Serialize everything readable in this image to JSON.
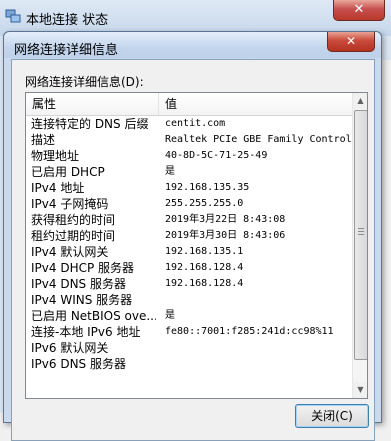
{
  "background_window": {
    "title": "本地连接 状态",
    "close_glyph": "✕",
    "icon": "network-connection-icon"
  },
  "dialog": {
    "title": "网络连接详细信息",
    "close_glyph": "✕",
    "section_label": "网络连接详细信息(D):",
    "columns": [
      "属性",
      "值"
    ],
    "rows": [
      {
        "key": "连接特定的 DNS 后缀",
        "value": "centit.com"
      },
      {
        "key": "描述",
        "value": "Realtek PCIe GBE Family Controller"
      },
      {
        "key": "物理地址",
        "value": "40-8D-5C-71-25-49"
      },
      {
        "key": "已启用 DHCP",
        "value": "是"
      },
      {
        "key": "IPv4 地址",
        "value": "192.168.135.35"
      },
      {
        "key": "IPv4 子网掩码",
        "value": "255.255.255.0"
      },
      {
        "key": "获得租约的时间",
        "value": "2019年3月22日 8:43:08"
      },
      {
        "key": "租约过期的时间",
        "value": "2019年3月30日 8:43:06"
      },
      {
        "key": "IPv4 默认网关",
        "value": "192.168.135.1"
      },
      {
        "key": "IPv4 DHCP 服务器",
        "value": "192.168.128.4"
      },
      {
        "key": "IPv4 DNS 服务器",
        "value": "192.168.128.4"
      },
      {
        "key": "IPv4 WINS 服务器",
        "value": ""
      },
      {
        "key": "已启用 NetBIOS ove...",
        "value": "是"
      },
      {
        "key": "连接-本地 IPv6 地址",
        "value": "fe80::7001:f285:241d:cc98%11"
      },
      {
        "key": "IPv6 默认网关",
        "value": ""
      },
      {
        "key": "IPv6 DNS 服务器",
        "value": ""
      }
    ],
    "close_button_label": "关闭(C)"
  }
}
